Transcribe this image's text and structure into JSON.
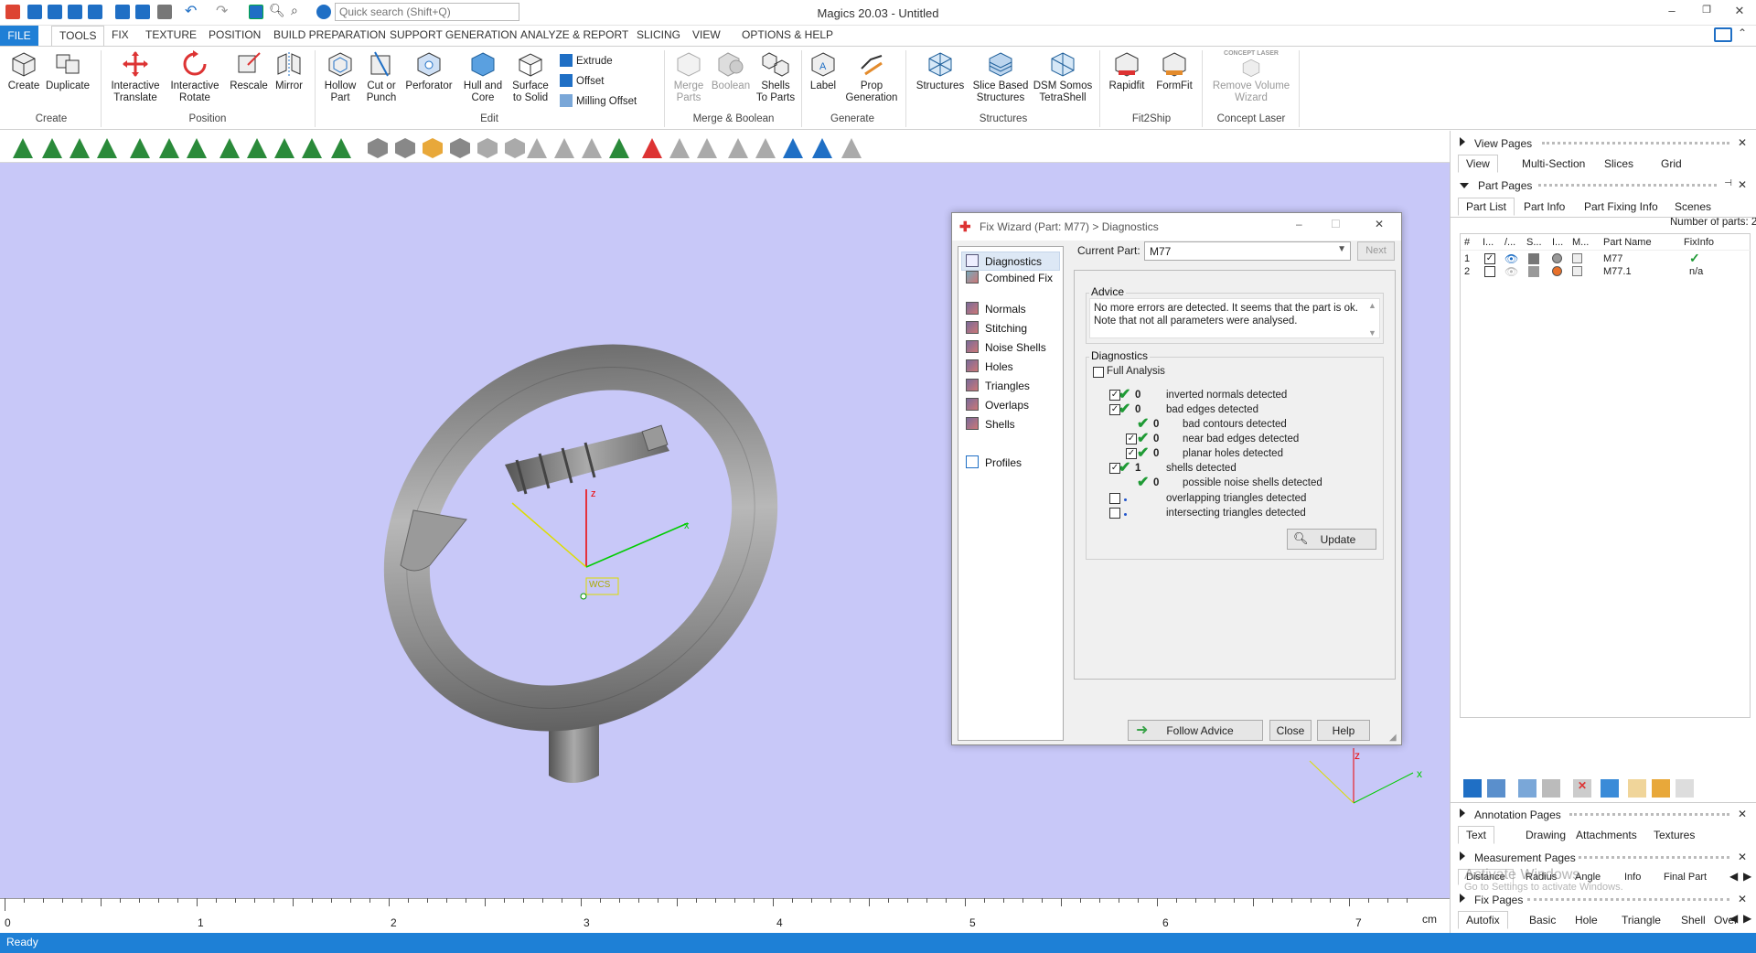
{
  "app": {
    "title": "Magics 20.03 - Untitled",
    "search_placeholder": "Quick search (Shift+Q)",
    "status": "Ready",
    "watermark_line1": "Activate Windows",
    "watermark_line2": "Go to Settings to activate Windows."
  },
  "menu": {
    "tabs": [
      "FILE",
      "TOOLS",
      "FIX",
      "TEXTURE",
      "POSITION",
      "BUILD PREPARATION",
      "SUPPORT GENERATION",
      "ANALYZE & REPORT",
      "SLICING",
      "VIEW",
      "OPTIONS & HELP"
    ],
    "active": "TOOLS"
  },
  "ribbon": {
    "create": {
      "label": "Create",
      "create": "Create",
      "duplicate": "Duplicate"
    },
    "position": {
      "label": "Position",
      "interactive_translate": "Interactive Translate",
      "interactive_rotate": "Interactive Rotate",
      "rescale": "Rescale",
      "mirror": "Mirror"
    },
    "edit": {
      "label": "Edit",
      "hollow_part": "Hollow Part",
      "cut_or_punch": "Cut or Punch",
      "perforator": "Perforator",
      "hull_and_core": "Hull and Core",
      "surface_to_solid": "Surface to Solid",
      "extrude": "Extrude",
      "offset": "Offset",
      "milling_offset": "Milling Offset"
    },
    "merge": {
      "label": "Merge & Boolean",
      "merge_parts": "Merge Parts",
      "boolean": "Boolean",
      "shells_to_parts": "Shells To Parts"
    },
    "generate": {
      "label": "Generate",
      "label_btn": "Label",
      "prop_generation": "Prop Generation"
    },
    "structures": {
      "label": "Structures",
      "structures": "Structures",
      "slice_based": "Slice Based Structures",
      "dsm": "DSM Somos TetraShell"
    },
    "fit2ship": {
      "label": "Fit2Ship",
      "rapidfit": "Rapidfit",
      "formfit": "FormFit"
    },
    "concept": {
      "label": "Concept Laser",
      "logo_text": "CONCEPT LASER",
      "remove_volume": "Remove Volume Wizard"
    }
  },
  "ruler": {
    "ticks": [
      "0",
      "1",
      "2",
      "3",
      "4",
      "5",
      "6",
      "7"
    ],
    "unit": "cm"
  },
  "viewport": {
    "wcs_label": "WCS"
  },
  "dialog": {
    "title": "Fix Wizard (Part: M77) > Diagnostics",
    "nav": [
      "Diagnostics",
      "Combined Fix",
      "Normals",
      "Stitching",
      "Noise Shells",
      "Holes",
      "Triangles",
      "Overlaps",
      "Shells",
      "Profiles"
    ],
    "current_part_label": "Current Part:",
    "current_part": "M77",
    "next": "Next",
    "advice_title": "Advice",
    "advice_text": "No more errors are detected. It seems that the part is ok. Note that not all parameters were analysed.",
    "diagnostics_title": "Diagnostics",
    "full_analysis": "Full Analysis",
    "rows": [
      {
        "count": "0",
        "label": "inverted normals detected",
        "checked": true,
        "ok": true
      },
      {
        "count": "0",
        "label": "bad edges detected",
        "checked": true,
        "ok": true
      },
      {
        "count": "0",
        "label": "bad contours detected",
        "checked": null,
        "ok": true
      },
      {
        "count": "0",
        "label": "near bad edges detected",
        "checked": true,
        "ok": true
      },
      {
        "count": "0",
        "label": "planar holes detected",
        "checked": true,
        "ok": true
      },
      {
        "count": "1",
        "label": "shells detected",
        "checked": true,
        "ok": true
      },
      {
        "count": "0",
        "label": "possible noise shells detected",
        "checked": null,
        "ok": true
      },
      {
        "count": "",
        "label": "overlapping triangles detected",
        "checked": false,
        "ok": false
      },
      {
        "count": "",
        "label": "intersecting triangles detected",
        "checked": false,
        "ok": false
      }
    ],
    "update": "Update",
    "follow_advice": "Follow Advice",
    "close": "Close",
    "help": "Help"
  },
  "right_panel": {
    "view_pages": {
      "title": "View Pages",
      "tabs": [
        "View",
        "Multi-Section",
        "Slices",
        "Grid"
      ]
    },
    "part_pages": {
      "title": "Part Pages",
      "tabs": [
        "Part List",
        "Part Info",
        "Part Fixing Info",
        "Scenes"
      ],
      "count_text": "Number of parts: 2"
    },
    "part_table": {
      "headers": [
        "#",
        "I...",
        "/...",
        "S...",
        "I...",
        "M...",
        "Part Name",
        "FixInfo"
      ],
      "rows": [
        {
          "num": "1",
          "name": "M77",
          "fixinfo": "✓",
          "visible": true,
          "color": "#888"
        },
        {
          "num": "2",
          "name": "M77.1",
          "fixinfo": "n/a",
          "visible": false,
          "color": "#e8702a"
        }
      ]
    },
    "annotation_pages": {
      "title": "Annotation Pages",
      "tabs": [
        "Text",
        "Drawing",
        "Attachments",
        "Textures"
      ]
    },
    "measurement_pages": {
      "title": "Measurement Pages",
      "tabs": [
        "Distance",
        "Radius",
        "Angle",
        "Info",
        "Final Part"
      ]
    },
    "fix_pages": {
      "title": "Fix Pages",
      "tabs": [
        "Autofix",
        "Basic",
        "Hole",
        "Triangle",
        "Shell",
        "Over"
      ]
    }
  }
}
